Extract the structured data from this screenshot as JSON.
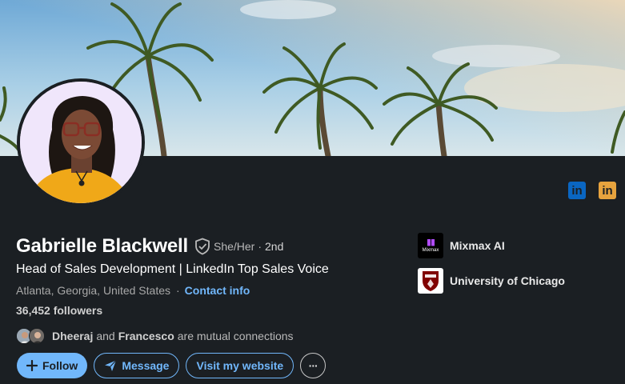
{
  "profile": {
    "name": "Gabrielle Blackwell",
    "pronouns": "She/Her",
    "separator": "·",
    "degree": "2nd",
    "headline": "Head of Sales Development | LinkedIn Top Sales Voice",
    "location": "Atlanta, Georgia, United States",
    "location_separator": "·",
    "contact_info_label": "Contact info",
    "followers": "36,452 followers"
  },
  "mutual": {
    "person1": "Dheeraj",
    "connector": "and",
    "person2": "Francesco",
    "suffix": "are mutual connections"
  },
  "actions": {
    "follow_label": "Follow",
    "message_label": "Message",
    "website_label": "Visit my website",
    "more_label": "···"
  },
  "social": {
    "linkedin_blue_icon": "in",
    "linkedin_orange_icon": "in"
  },
  "sidebar": {
    "items": [
      {
        "label": "Mixmax AI",
        "logo_text": "Mixmax",
        "icon": "mixmax-logo"
      },
      {
        "label": "University of Chicago",
        "icon": "uchicago-shield"
      }
    ]
  },
  "colors": {
    "background": "#1b1f23",
    "accent": "#71b7fb",
    "linkedin_blue": "#0a66c2",
    "linkedin_orange": "#e7a33e",
    "photo_background": "#f3e8ff",
    "shirt": "#f0a818",
    "uchicago_maroon": "#800000"
  }
}
